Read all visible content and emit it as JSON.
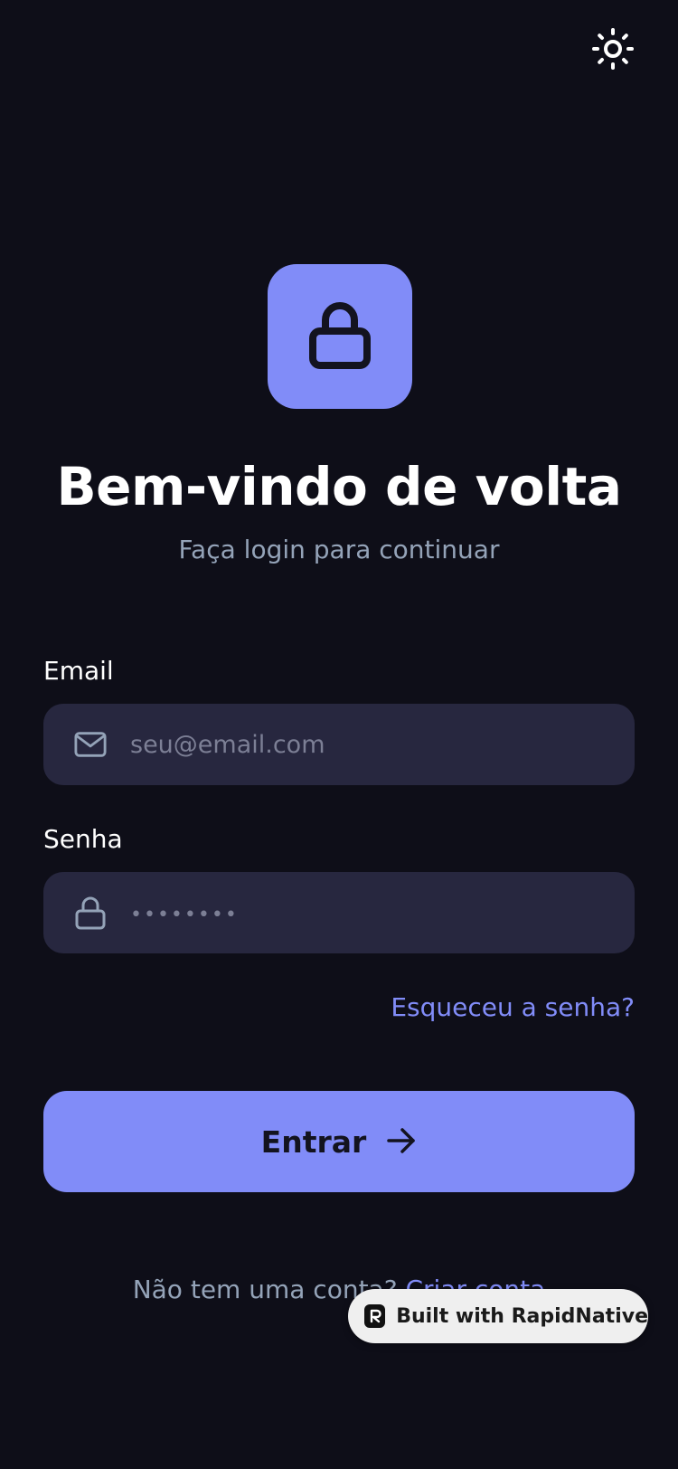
{
  "header": {
    "theme_toggle_icon": "sun-icon"
  },
  "hero": {
    "logo_icon": "lock-icon",
    "logo_bg_color": "#818cf8",
    "title": "Bem-vindo de volta",
    "subtitle": "Faça login para continuar"
  },
  "form": {
    "email": {
      "label": "Email",
      "icon": "mail-icon",
      "placeholder": "seu@email.com",
      "value": ""
    },
    "password": {
      "label": "Senha",
      "icon": "lock-icon",
      "placeholder": "••••••••",
      "value": ""
    },
    "forgot_password": "Esqueceu a senha?",
    "submit_label": "Entrar",
    "submit_icon": "arrow-right-icon"
  },
  "footer": {
    "prompt": "Não tem uma conta? ",
    "signup_link": "Criar conta"
  },
  "badge": {
    "label": "Built with RapidNative",
    "icon": "rapidnative-logo-icon"
  },
  "colors": {
    "background": "#0e0e18",
    "accent": "#818cf8",
    "input_bg": "#27273f",
    "muted_text": "#94a3b8"
  }
}
